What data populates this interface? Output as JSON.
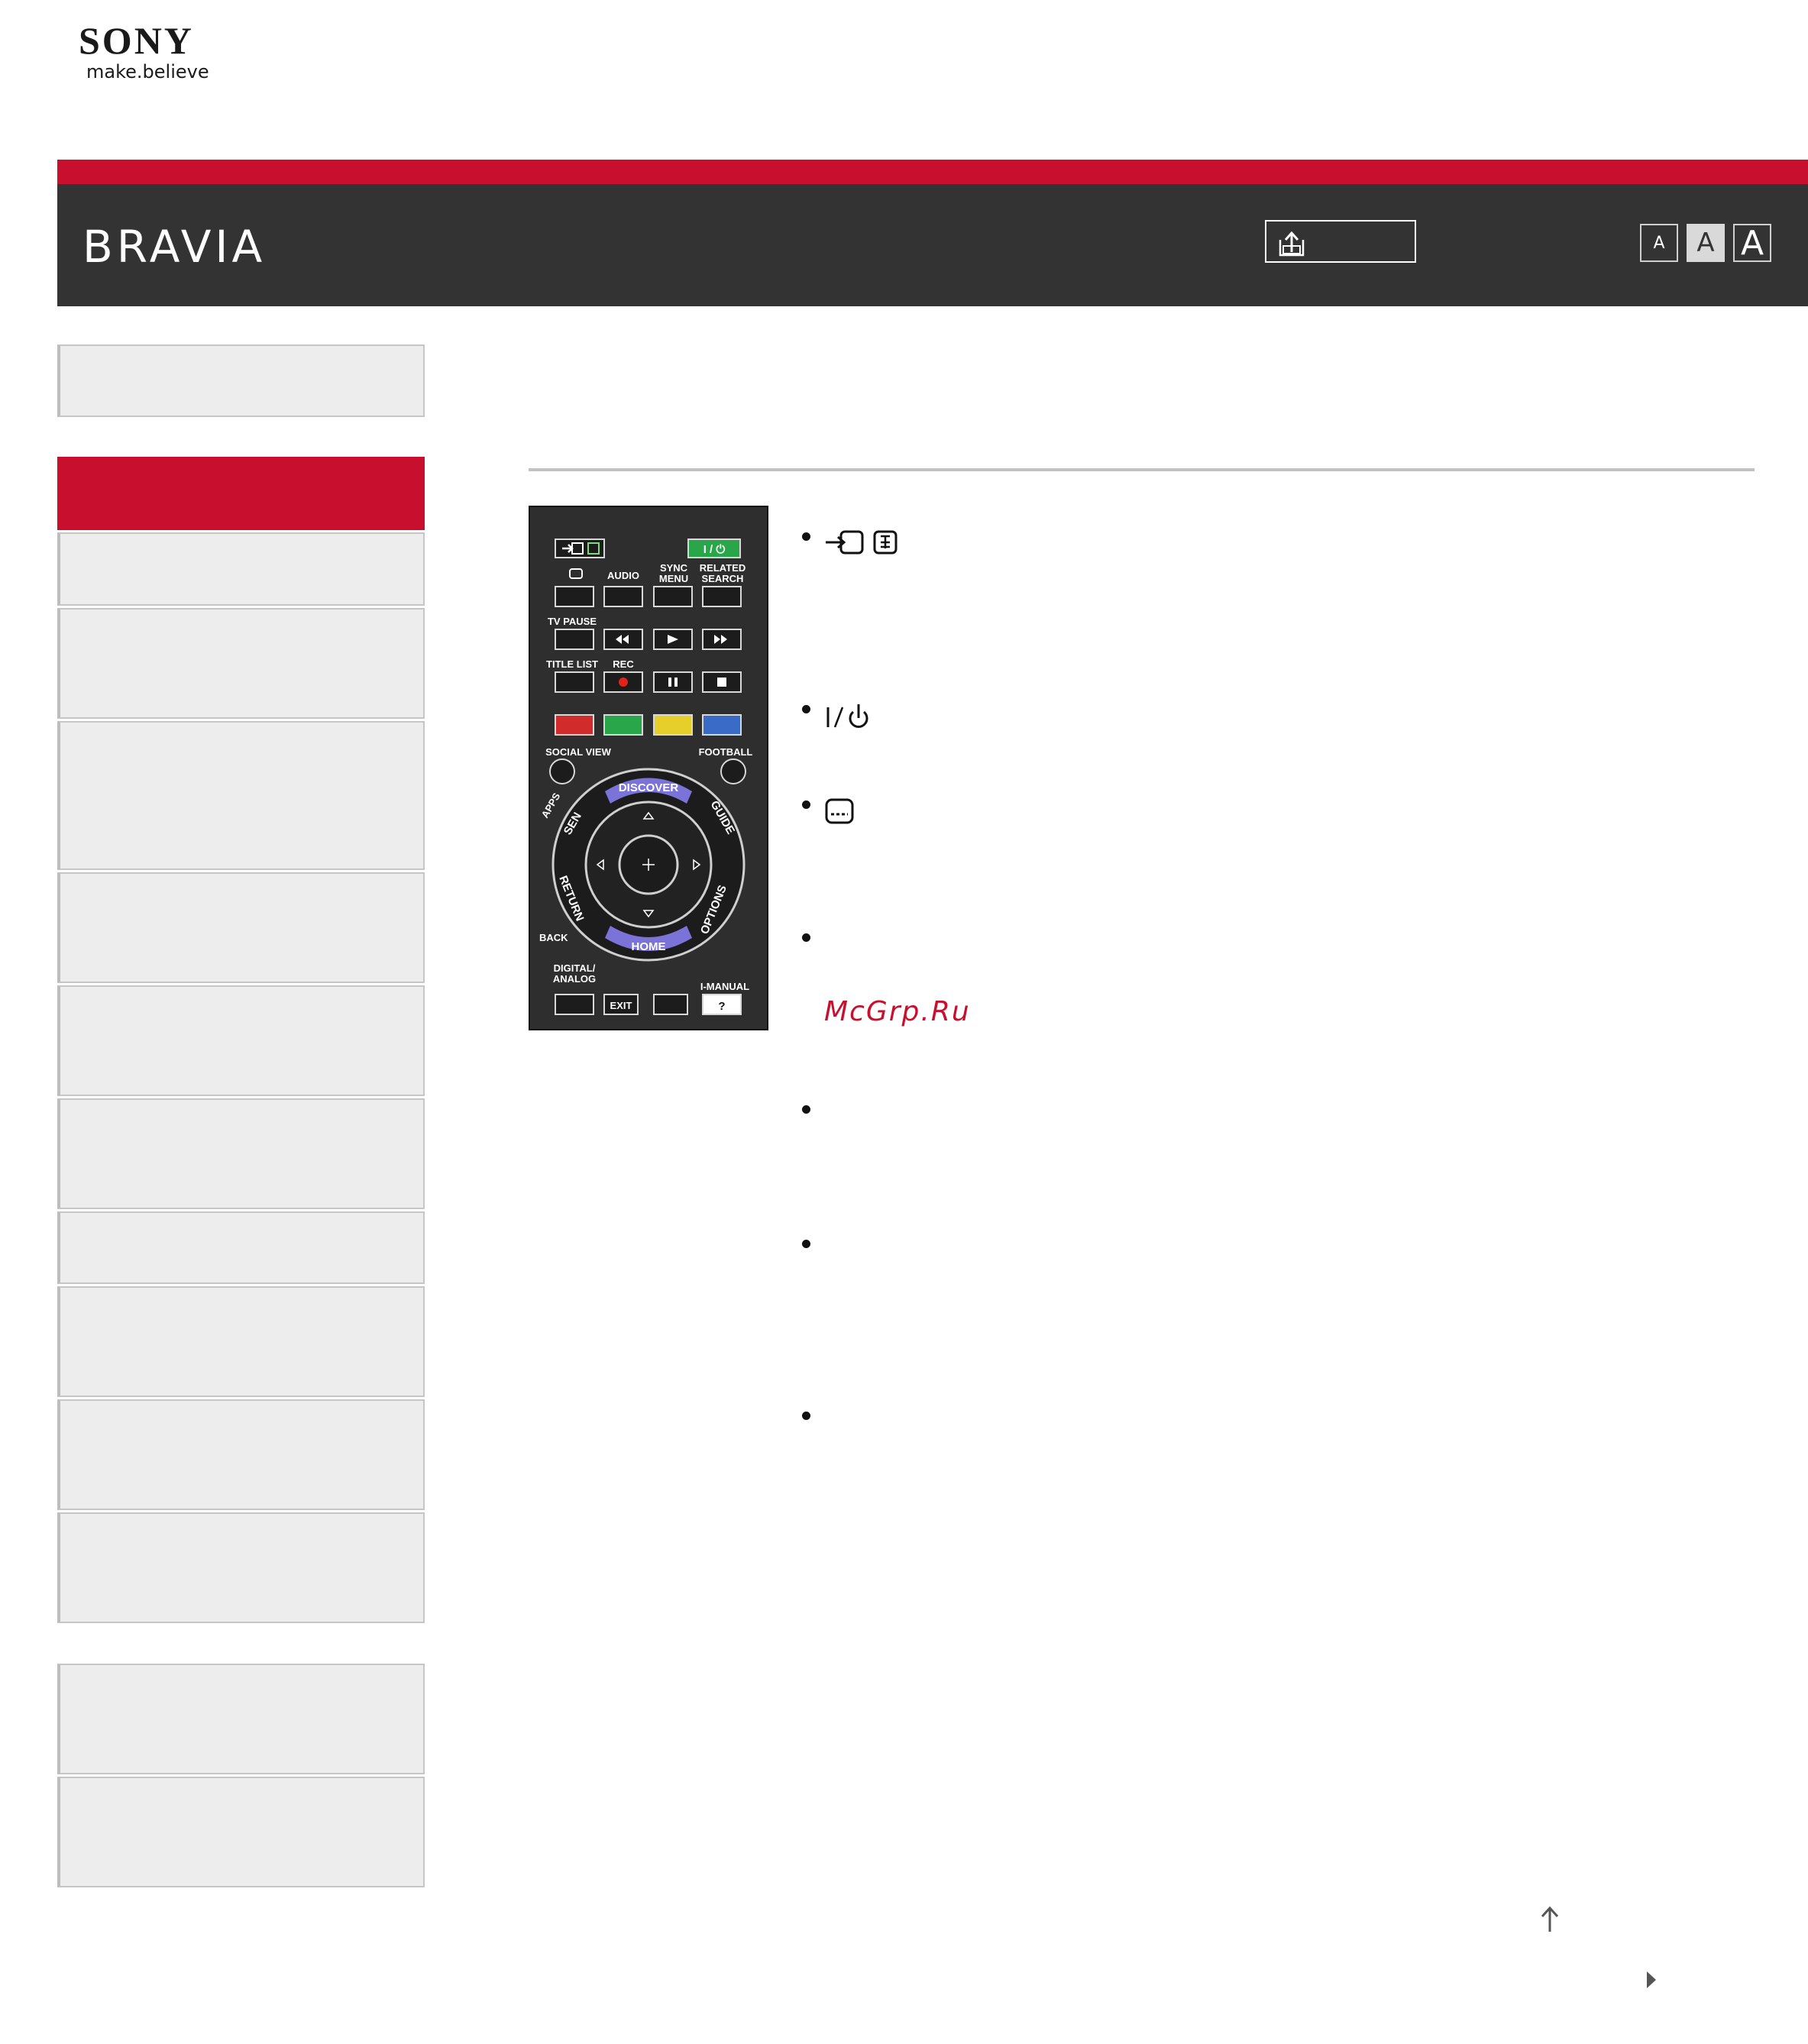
{
  "logo": {
    "brand": "SONY",
    "tagline": "make.believe"
  },
  "header": {
    "product": "BRAVIA",
    "font_size_labels": [
      "A",
      "A",
      "A"
    ],
    "accent": "#c8102e",
    "bar_color": "#333333"
  },
  "content": {
    "icons": [
      "input-icon",
      "teletext-icon",
      "power-icon",
      "subtitle-icon"
    ],
    "power_symbol": "I/⏻",
    "watermark": "McGrp.Ru"
  },
  "remote": {
    "labels": {
      "audio": "AUDIO",
      "sync_menu_1": "SYNC",
      "sync_menu_2": "MENU",
      "related_1": "RELATED",
      "related_2": "SEARCH",
      "power": "I / ⏻",
      "tv_pause": "TV PAUSE",
      "title_list": "TITLE LIST",
      "rec": "REC",
      "social_view": "SOCIAL VIEW",
      "football": "FOOTBALL",
      "discover": "DISCOVER",
      "apps": "APPS",
      "sen": "SEN",
      "guide": "GUIDE",
      "return": "RETURN",
      "options": "OPTIONS",
      "home": "HOME",
      "back": "BACK",
      "digital_1": "DIGITAL/",
      "digital_2": "ANALOG",
      "exit": "EXIT",
      "i_manual": "I-MANUAL",
      "help": "?"
    }
  }
}
